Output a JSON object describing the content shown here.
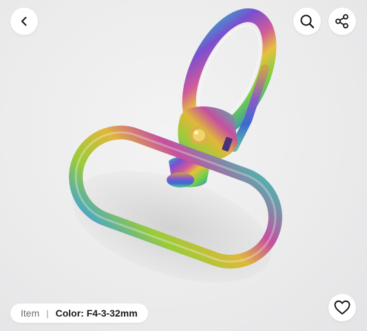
{
  "gallery": {
    "product_image_alt": "Rainbow iridescent swivel snap hook clasp"
  },
  "toolbar": {
    "back_icon": "chevron-left-icon",
    "search_icon": "search-icon",
    "share_icon": "share-icon"
  },
  "variant_bar": {
    "item_label": "Item",
    "separator": "|",
    "color_label": "Color: F4-3-32mm"
  },
  "actions": {
    "favorite_icon": "heart-icon"
  }
}
